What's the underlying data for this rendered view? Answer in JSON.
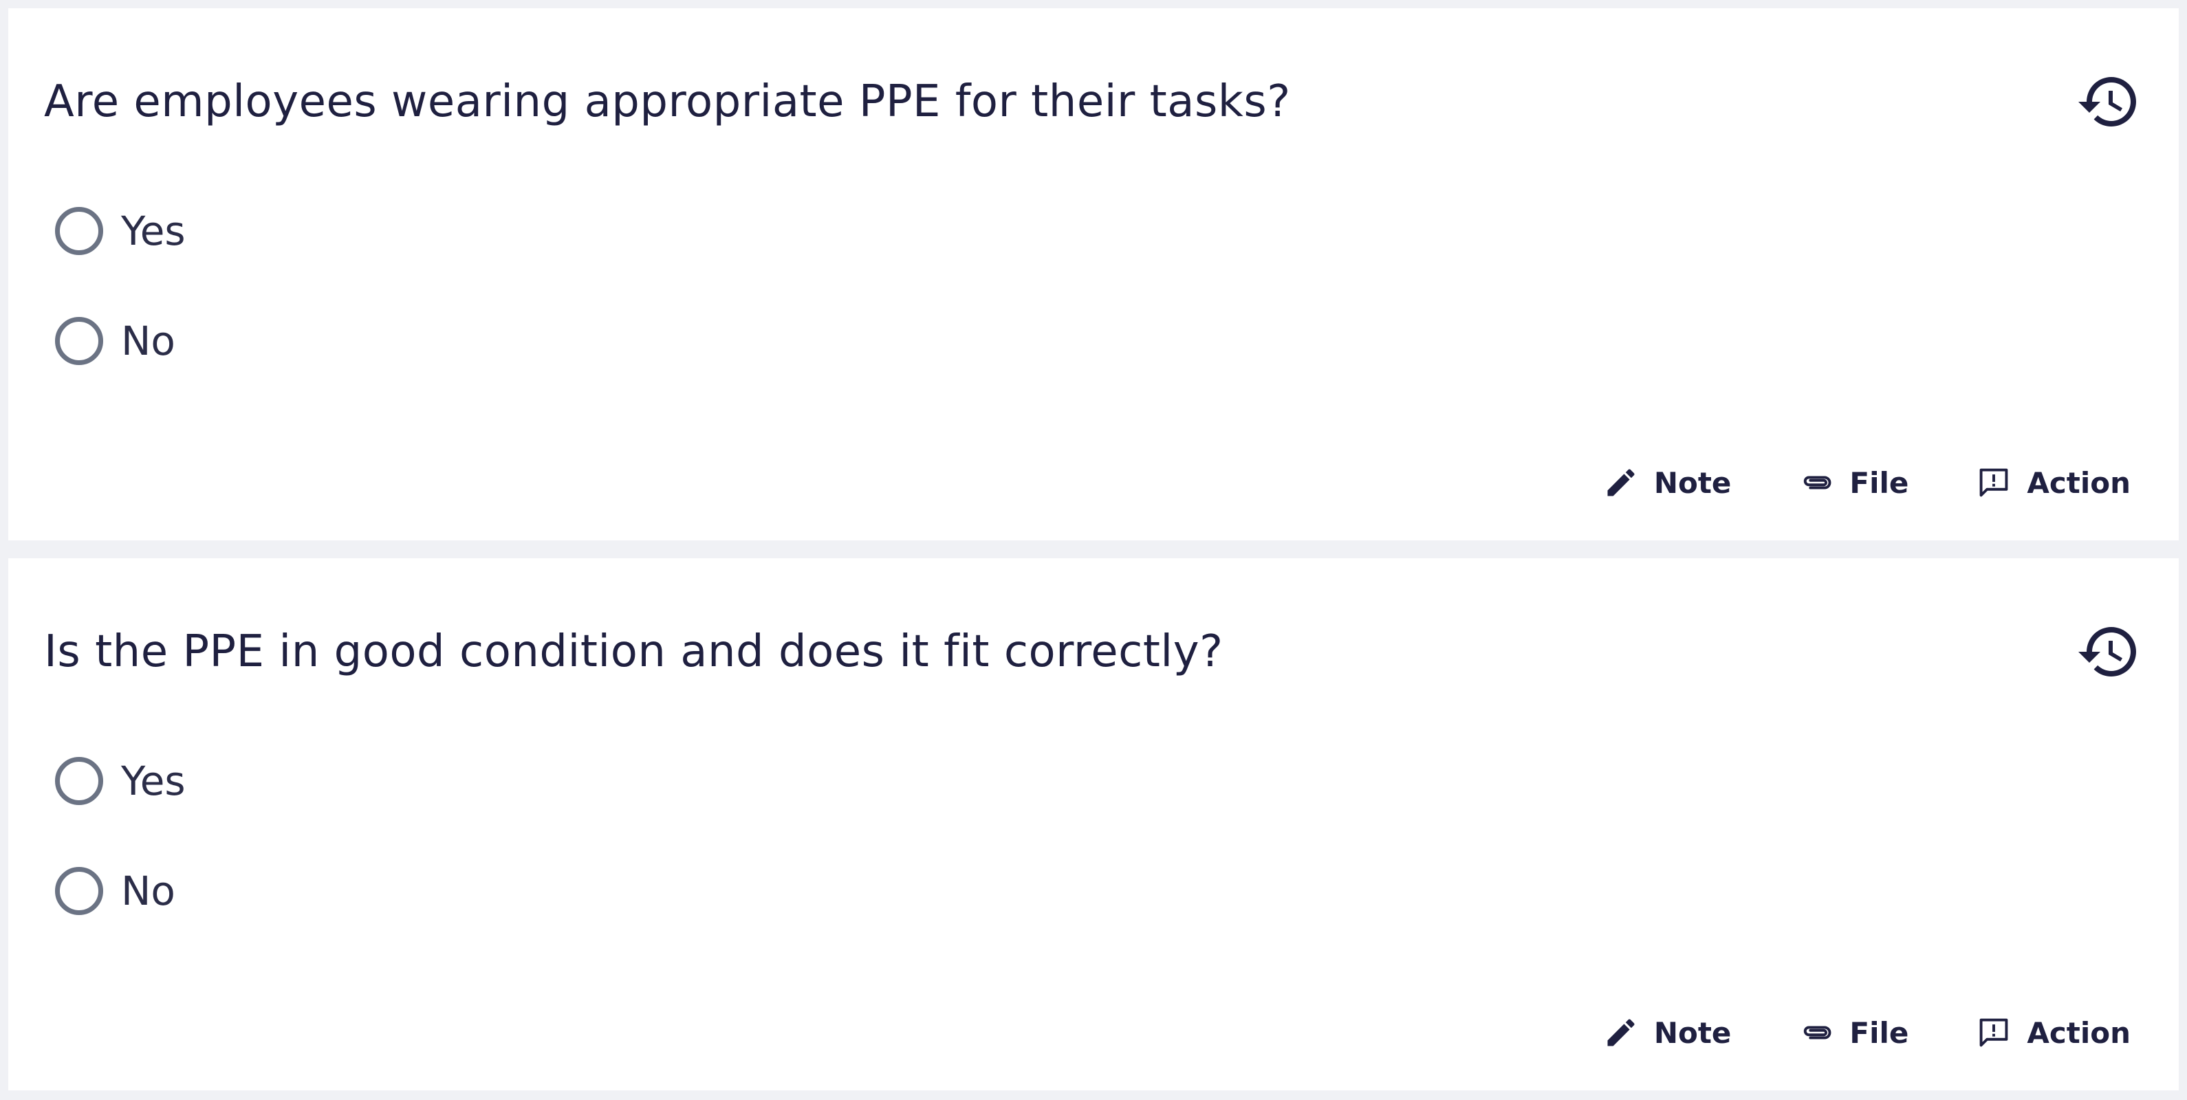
{
  "questions": [
    {
      "text": "Are employees wearing appropriate PPE for their tasks?",
      "options": [
        {
          "label": "Yes",
          "selected": false
        },
        {
          "label": "No",
          "selected": false
        }
      ],
      "history_icon": "history-icon"
    },
    {
      "text": "Is the PPE in good condition and does it fit correctly?",
      "options": [
        {
          "label": "Yes",
          "selected": false
        },
        {
          "label": "No",
          "selected": false
        }
      ],
      "history_icon": "history-icon"
    }
  ],
  "footer_actions": {
    "note": {
      "label": "Note",
      "icon": "pencil-icon"
    },
    "file": {
      "label": "File",
      "icon": "paperclip-icon"
    },
    "action": {
      "label": "Action",
      "icon": "alert-comment-icon"
    }
  },
  "colors": {
    "page_background": "#f0f1f5",
    "card_background": "#ffffff",
    "text": "#1f2040",
    "radio_border": "#6b7384"
  }
}
